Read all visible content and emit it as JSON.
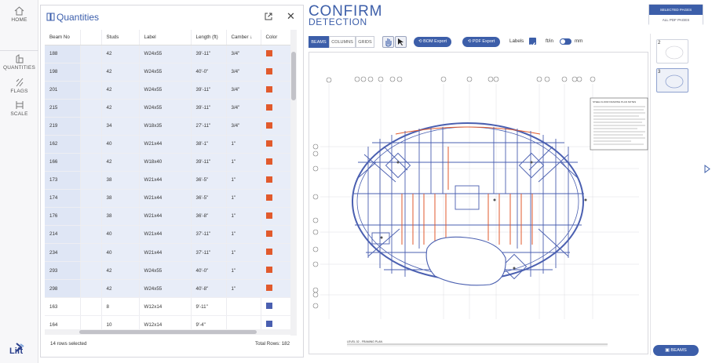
{
  "nav": {
    "home": "HOME",
    "quantities": "QUANTITIES",
    "flags": "FLAGS",
    "scale": "SCALE",
    "logo": "Lift"
  },
  "panel": {
    "title": "Quantities",
    "columns": [
      "Beam No",
      "Studs",
      "Label",
      "Length (ft)",
      "Camber",
      "Color"
    ],
    "rows": [
      {
        "beam": "188",
        "studs": "42",
        "label": "W24x55",
        "length": "39'-11\"",
        "camber": "3/4\"",
        "color": "#e15a2c",
        "selected": true
      },
      {
        "beam": "198",
        "studs": "42",
        "label": "W24x55",
        "length": "40'-0\"",
        "camber": "3/4\"",
        "color": "#e15a2c",
        "selected": true
      },
      {
        "beam": "201",
        "studs": "42",
        "label": "W24x55",
        "length": "39'-11\"",
        "camber": "3/4\"",
        "color": "#e15a2c",
        "selected": true
      },
      {
        "beam": "215",
        "studs": "42",
        "label": "W24x55",
        "length": "39'-11\"",
        "camber": "3/4\"",
        "color": "#e15a2c",
        "selected": true
      },
      {
        "beam": "219",
        "studs": "34",
        "label": "W18x35",
        "length": "27'-11\"",
        "camber": "3/4\"",
        "color": "#e15a2c",
        "selected": true
      },
      {
        "beam": "162",
        "studs": "40",
        "label": "W21x44",
        "length": "38'-1\"",
        "camber": "1\"",
        "color": "#e15a2c",
        "selected": true
      },
      {
        "beam": "166",
        "studs": "42",
        "label": "W18x40",
        "length": "39'-11\"",
        "camber": "1\"",
        "color": "#e15a2c",
        "selected": true
      },
      {
        "beam": "173",
        "studs": "38",
        "label": "W21x44",
        "length": "36'-5\"",
        "camber": "1\"",
        "color": "#e15a2c",
        "selected": true
      },
      {
        "beam": "174",
        "studs": "38",
        "label": "W21x44",
        "length": "36'-5\"",
        "camber": "1\"",
        "color": "#e15a2c",
        "selected": true
      },
      {
        "beam": "176",
        "studs": "38",
        "label": "W21x44",
        "length": "36'-8\"",
        "camber": "1\"",
        "color": "#e15a2c",
        "selected": true
      },
      {
        "beam": "214",
        "studs": "40",
        "label": "W21x44",
        "length": "37'-11\"",
        "camber": "1\"",
        "color": "#e15a2c",
        "selected": true
      },
      {
        "beam": "234",
        "studs": "40",
        "label": "W21x44",
        "length": "37'-11\"",
        "camber": "1\"",
        "color": "#e15a2c",
        "selected": true
      },
      {
        "beam": "293",
        "studs": "42",
        "label": "W24x55",
        "length": "40'-0\"",
        "camber": "1\"",
        "color": "#e15a2c",
        "selected": true
      },
      {
        "beam": "298",
        "studs": "42",
        "label": "W24x55",
        "length": "40'-8\"",
        "camber": "1\"",
        "color": "#e15a2c",
        "selected": true
      },
      {
        "beam": "163",
        "studs": "8",
        "label": "W12x14",
        "length": "9'-11\"",
        "camber": "",
        "color": "#4a5fb0",
        "selected": false
      },
      {
        "beam": "164",
        "studs": "10",
        "label": "W12x14",
        "length": "9'-4\"",
        "camber": "",
        "color": "#4a5fb0",
        "selected": false
      }
    ],
    "rows_selected": "14 rows selected",
    "total_rows": "Total Rows: 182"
  },
  "header": {
    "title_line1": "CONFIRM",
    "title_line2": "DETECTION"
  },
  "toolbar": {
    "tabs": [
      "BEAMS",
      "COLUMNS",
      "GRIDS"
    ],
    "bom_export": "BOM Export",
    "pdf_export": "PDF Export",
    "labels": "Labels",
    "unit_left": "ft/in",
    "unit_right": "mm"
  },
  "page_selector": {
    "selected": "SELECTED PAGES",
    "all": "ALL PDF PAGES"
  },
  "drawing": {
    "notes_title": "STEEL FLOOR FRAMING PLAN NOTES",
    "plan_label": "LEVEL 02 - FRAMING PLAN"
  },
  "thumbnails": [
    "2",
    "3"
  ],
  "beams_button": "BEAMS",
  "colors": {
    "accent": "#3c5ea9",
    "beam_highlight": "#e15a2c",
    "beam_default": "#4a5fb0"
  }
}
